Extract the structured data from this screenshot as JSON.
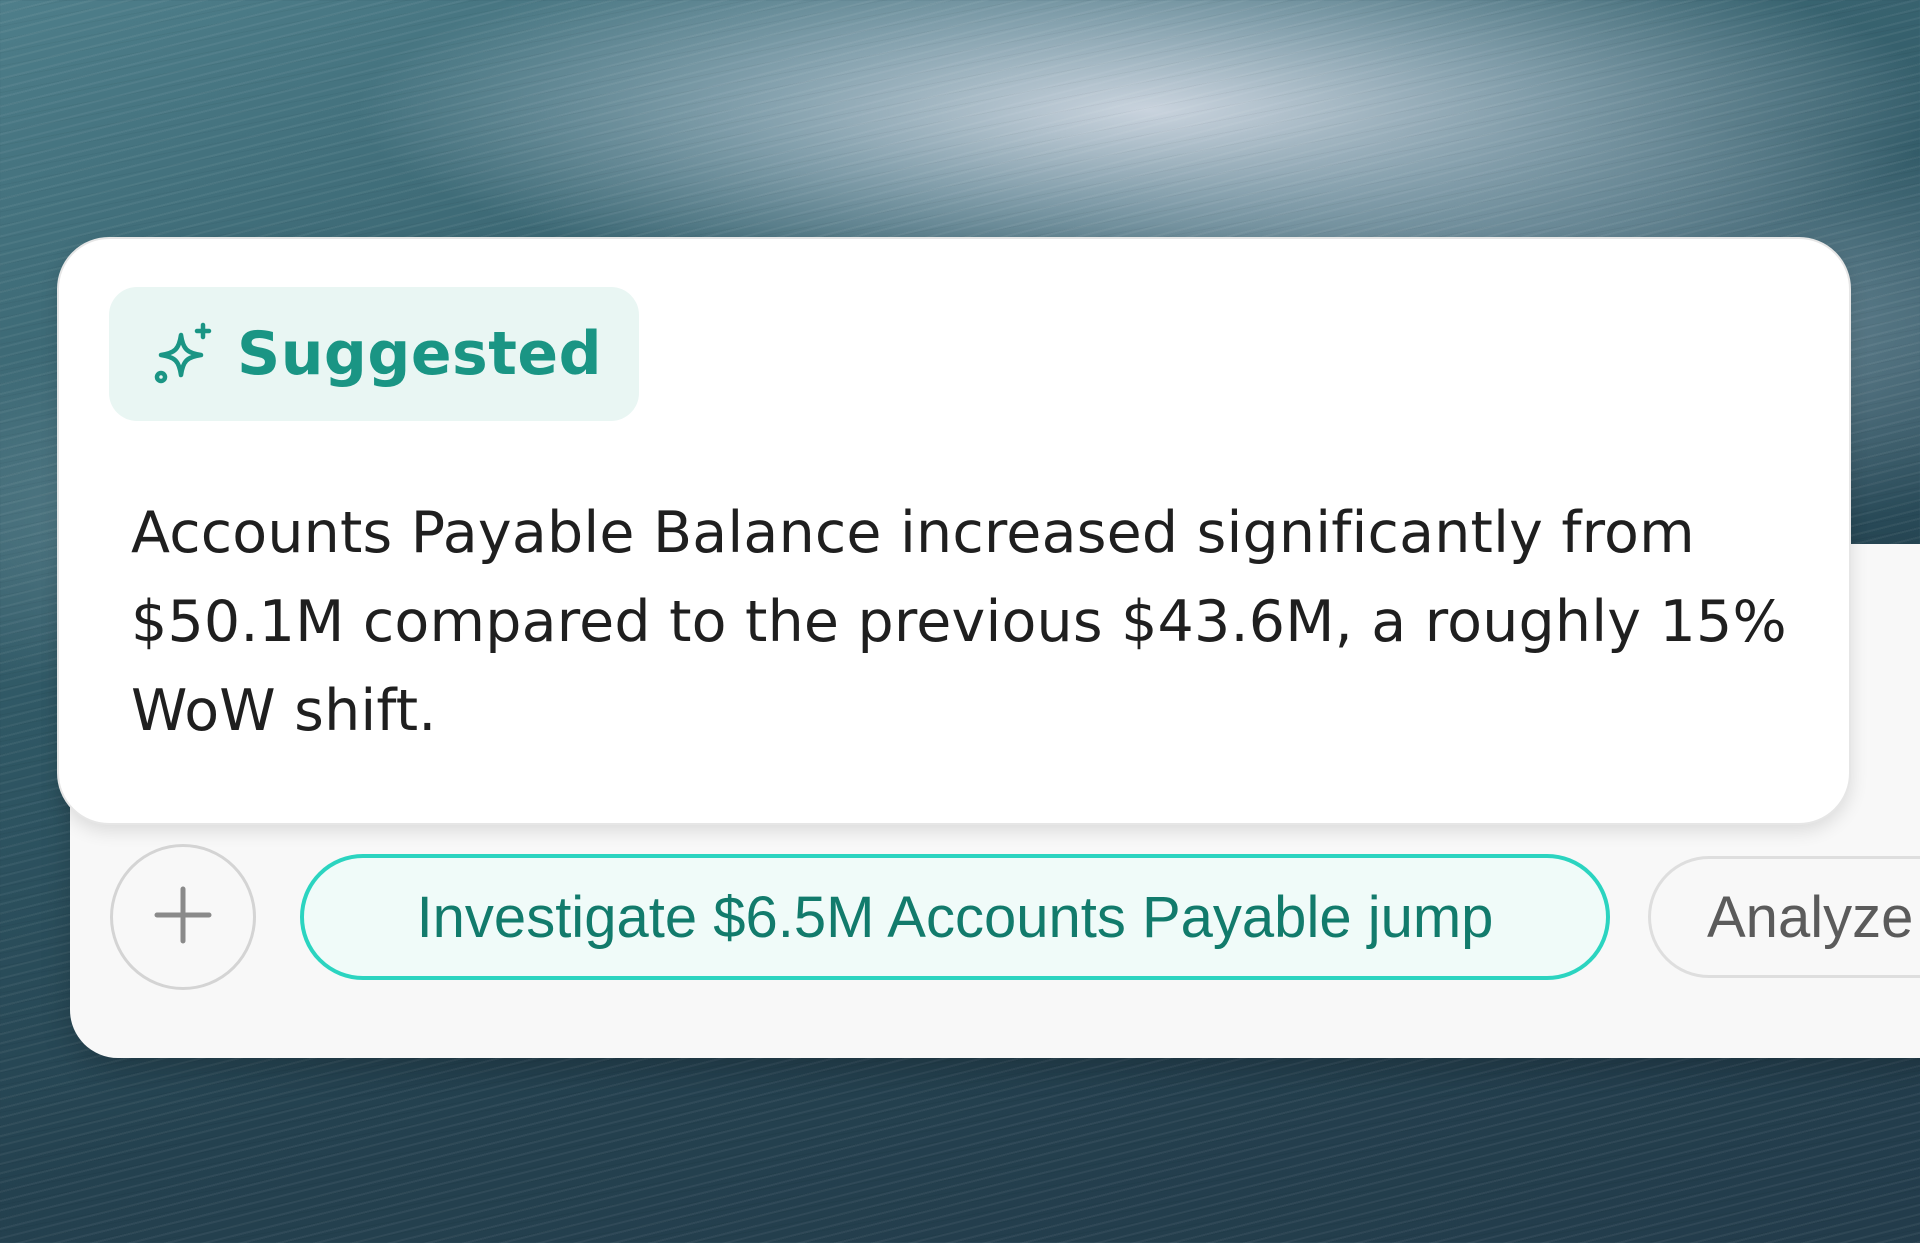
{
  "suggestion": {
    "badge_label": "Suggested",
    "badge_icon": "sparkle-icon",
    "text": "Accounts Payable Balance increased significantly from $50.1M compared to the previous $43.6M, a roughly 15% WoW shift."
  },
  "composer": {
    "add_icon": "plus-icon",
    "chips": [
      {
        "label": "Investigate $6.5M Accounts Payable jump"
      },
      {
        "label": "Analyze"
      }
    ]
  },
  "colors": {
    "accent": "#1a9584",
    "chip_border": "#2bd4c0",
    "badge_bg": "#e9f6f3"
  }
}
